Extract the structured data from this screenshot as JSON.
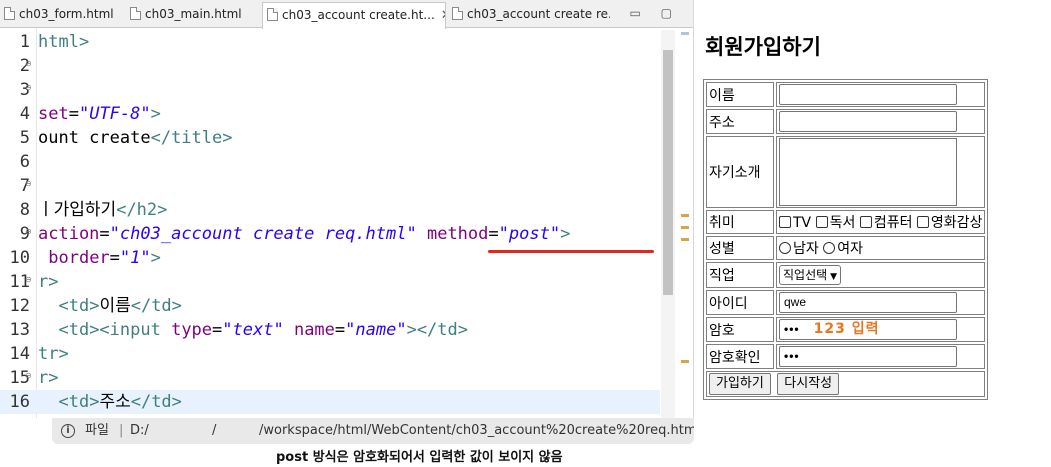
{
  "editor": {
    "tabs": [
      {
        "label": "ch03_form.html",
        "active": false
      },
      {
        "label": "ch03_main.html",
        "active": false
      },
      {
        "label": "ch03_account create.ht...",
        "active": true,
        "close": "✕"
      },
      {
        "label": "ch03_account create re...",
        "active": false
      }
    ],
    "window_controls": "▭ ▢",
    "lines": [
      {
        "n": "1",
        "fold": "",
        "parts": [
          [
            "tag",
            "html>"
          ]
        ]
      },
      {
        "n": "2",
        "fold": "⊖",
        "parts": []
      },
      {
        "n": "3",
        "fold": "⊖",
        "parts": []
      },
      {
        "n": "4",
        "fold": "",
        "parts": [
          [
            "attr",
            "set"
          ],
          [
            "txt",
            "="
          ],
          [
            "val",
            "\"UTF-8\""
          ],
          [
            "tag",
            ">"
          ]
        ]
      },
      {
        "n": "5",
        "fold": "",
        "parts": [
          [
            "txt",
            "ount create"
          ],
          [
            "tag",
            "</title>"
          ]
        ]
      },
      {
        "n": "6",
        "fold": "",
        "parts": []
      },
      {
        "n": "7",
        "fold": "⊖",
        "parts": []
      },
      {
        "n": "8",
        "fold": "",
        "parts": [
          [
            "txt",
            "ㅣ가입하기"
          ],
          [
            "tag",
            "</h2>"
          ]
        ]
      },
      {
        "n": "9",
        "fold": "⊖",
        "parts": [
          [
            "attr",
            "action"
          ],
          [
            "txt",
            "="
          ],
          [
            "val",
            "\"ch03_account create req.html\""
          ],
          [
            "txt",
            " "
          ],
          [
            "attr",
            "method"
          ],
          [
            "txt",
            "="
          ],
          [
            "val",
            "\"post\""
          ],
          [
            "tag",
            ">"
          ]
        ]
      },
      {
        "n": "10",
        "fold": "",
        "parts": [
          [
            "txt",
            " "
          ],
          [
            "attr",
            "border"
          ],
          [
            "txt",
            "="
          ],
          [
            "val",
            "\"1\""
          ],
          [
            "tag",
            ">"
          ]
        ]
      },
      {
        "n": "11",
        "fold": "⊖",
        "parts": [
          [
            "tag",
            "r>"
          ]
        ]
      },
      {
        "n": "12",
        "fold": "",
        "parts": [
          [
            "txt",
            "  "
          ],
          [
            "tag",
            "<td>"
          ],
          [
            "txt",
            "이름"
          ],
          [
            "tag",
            "</td>"
          ]
        ]
      },
      {
        "n": "13",
        "fold": "",
        "parts": [
          [
            "txt",
            "  "
          ],
          [
            "tag",
            "<td><input "
          ],
          [
            "attr",
            "type"
          ],
          [
            "txt",
            "="
          ],
          [
            "val",
            "\"text\""
          ],
          [
            "txt",
            " "
          ],
          [
            "attr",
            "name"
          ],
          [
            "txt",
            "="
          ],
          [
            "val",
            "\"name\""
          ],
          [
            "tag",
            "></td>"
          ]
        ]
      },
      {
        "n": "14",
        "fold": "",
        "parts": [
          [
            "tag",
            "tr>"
          ]
        ]
      },
      {
        "n": "15",
        "fold": "⊖",
        "parts": [
          [
            "tag",
            "r>"
          ]
        ]
      },
      {
        "n": "16",
        "fold": "",
        "current": true,
        "parts": [
          [
            "txt",
            "  "
          ],
          [
            "tag",
            "<td>"
          ],
          [
            "txt",
            "주소"
          ],
          [
            "tag",
            "</td>"
          ]
        ]
      }
    ]
  },
  "statusbar": {
    "file_label": "파일",
    "separator": "|",
    "path_drive": "D:/",
    "path_slash": "/",
    "path_rest": "/workspace/html/WebContent/ch03_account%20create%20req.html",
    "info_icon": "i"
  },
  "caption": "post 방식은 암호화되어서 입력한 값이 보이지 않음",
  "preview": {
    "title": "회원가입하기",
    "rows": {
      "name_label": "이름",
      "name_value": "",
      "address_label": "주소",
      "address_value": "",
      "intro_label": "자기소개",
      "hobby_label": "취미",
      "hobby_options": [
        "TV",
        "독서",
        "컴퓨터",
        "영화감상"
      ],
      "gender_label": "성별",
      "gender_options": [
        "남자",
        "여자"
      ],
      "job_label": "직업",
      "job_selected": "직업선택",
      "id_label": "아이디",
      "id_value": "qwe",
      "pw_label": "암호",
      "pw_value": "•••",
      "pw_note": "123 입력",
      "pw2_label": "암호확인",
      "pw2_value": "•••",
      "submit_label": "가입하기",
      "reset_label": "다시작성"
    }
  },
  "colors": {
    "tag": "#3f7f7f",
    "attr": "#7f007f",
    "value": "#2a00ff",
    "annotation_red": "#e0281e",
    "note_orange": "#e87722"
  }
}
